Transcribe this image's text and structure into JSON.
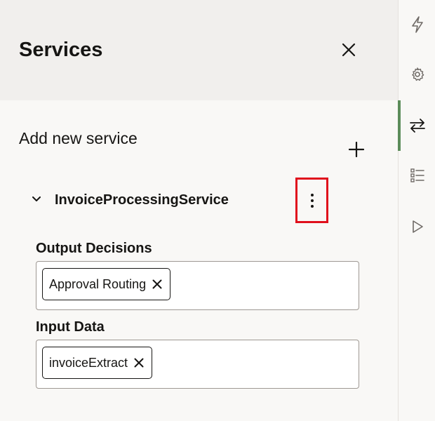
{
  "panel": {
    "title": "Services",
    "add_label": "Add new service"
  },
  "service": {
    "name": "InvoiceProcessingService",
    "output_decisions": {
      "label": "Output Decisions",
      "chips": [
        "Approval Routing"
      ]
    },
    "input_data": {
      "label": "Input Data",
      "chips": [
        "invoiceExtract"
      ]
    }
  },
  "rail": {
    "items": [
      {
        "icon": "lightning-icon",
        "active": false
      },
      {
        "icon": "gear-icon",
        "active": false
      },
      {
        "icon": "swap-arrows-icon",
        "active": true
      },
      {
        "icon": "checklist-icon",
        "active": false
      },
      {
        "icon": "play-icon",
        "active": false
      }
    ]
  },
  "colors": {
    "header_bg": "#f1efed",
    "panel_bg": "#f9f8f6",
    "highlight_border": "#e0101c",
    "active_indicator": "#5c8c5a"
  }
}
